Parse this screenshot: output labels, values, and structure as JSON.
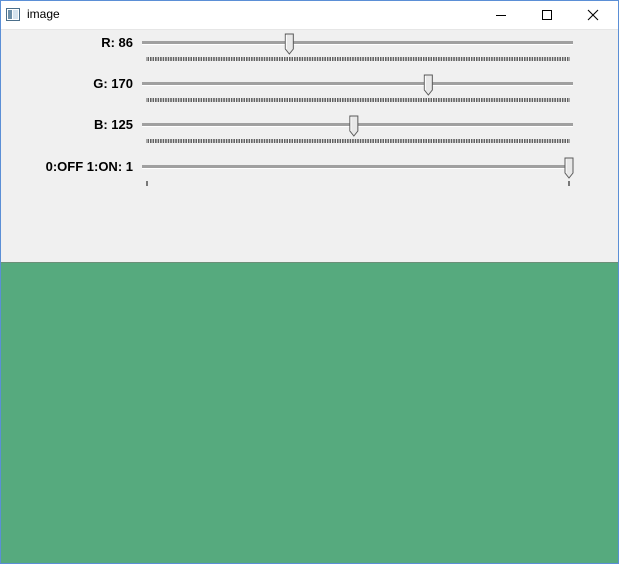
{
  "window": {
    "title": "image",
    "icon": "opencv-window-icon"
  },
  "window_controls": {
    "minimize": "minimize-icon",
    "maximize": "maximize-icon",
    "close": "close-icon"
  },
  "trackbars": [
    {
      "label": "R: 86",
      "value": 86,
      "min": 0,
      "max": 255
    },
    {
      "label": "G: 170",
      "value": 170,
      "min": 0,
      "max": 255
    },
    {
      "label": "B: 125",
      "value": 125,
      "min": 0,
      "max": 255
    },
    {
      "label": "0:OFF 1:ON: 1",
      "value": 1,
      "min": 0,
      "max": 1
    }
  ],
  "image": {
    "fill_color": "#56aa7e"
  },
  "colors": {
    "window_bg": "#f0f0f0",
    "titlebar_bg": "#ffffff",
    "border": "#5b8fd6"
  }
}
